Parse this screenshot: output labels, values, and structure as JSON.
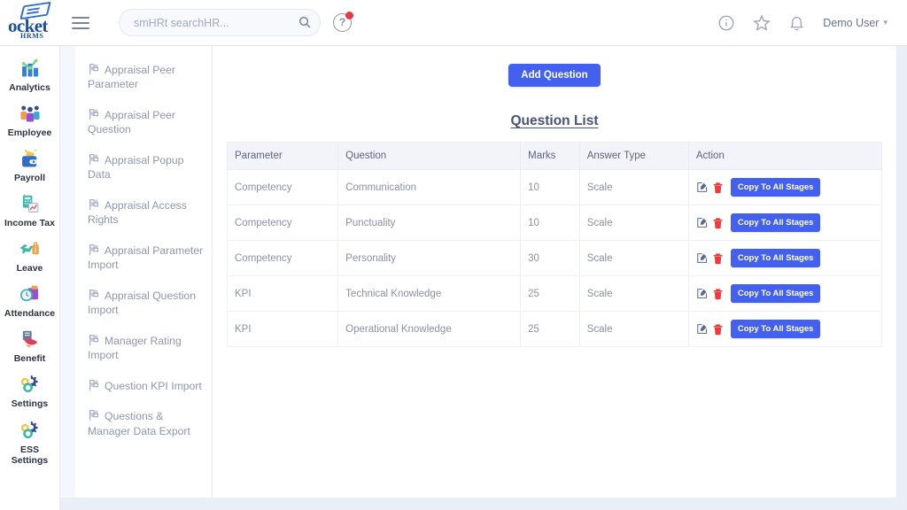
{
  "header": {
    "logo_text": "ocket",
    "logo_sub": "HRMS",
    "menu_icon": "hamburger-icon",
    "search": {
      "placeholder": "smHRt searchHR...",
      "value": "",
      "icon": "search-icon"
    },
    "help_icon": "help-circle-icon",
    "help_badge": true,
    "info_icon": "info-circle-icon",
    "star_icon": "star-icon",
    "bell_icon": "bell-icon",
    "user_label": "Demo User",
    "user_caret": "▾"
  },
  "rail": {
    "items": [
      {
        "label": "Analytics",
        "icon": "analytics-icon"
      },
      {
        "label": "Employee",
        "icon": "employee-icon"
      },
      {
        "label": "Payroll",
        "icon": "payroll-icon"
      },
      {
        "label": "Income Tax",
        "icon": "income-tax-icon"
      },
      {
        "label": "Leave",
        "icon": "leave-icon"
      },
      {
        "label": "Attendance",
        "icon": "attendance-icon"
      },
      {
        "label": "Benefit",
        "icon": "benefit-icon"
      },
      {
        "label": "Settings",
        "icon": "settings-icon"
      },
      {
        "label": "ESS Settings",
        "icon": "ess-settings-icon"
      }
    ]
  },
  "submenu": {
    "items": [
      {
        "label": "Appraisal Peer Parameter",
        "icon": "flag-icon"
      },
      {
        "label": "Appraisal Peer Question",
        "icon": "flag-icon"
      },
      {
        "label": "Appraisal Popup Data",
        "icon": "flag-icon"
      },
      {
        "label": "Appraisal Access Rights",
        "icon": "flag-icon"
      },
      {
        "label": "Appraisal Parameter Import",
        "icon": "flag-icon"
      },
      {
        "label": "Appraisal Question Import",
        "icon": "flag-icon"
      },
      {
        "label": "Manager Rating Import",
        "icon": "flag-icon"
      },
      {
        "label": "Question KPI Import",
        "icon": "flag-icon"
      },
      {
        "label": "Questions & Manager Data Export",
        "icon": "flag-icon"
      }
    ]
  },
  "main": {
    "add_button": "Add Question",
    "list_title": "Question List",
    "table": {
      "columns": [
        "Parameter",
        "Question",
        "Marks",
        "Answer Type",
        "Action"
      ],
      "rows": [
        {
          "parameter": "Competency",
          "question": "Communication",
          "marks": "10",
          "answer_type": "Scale",
          "edit_icon": "edit-icon",
          "delete_icon": "trash-icon",
          "copy_label": "Copy To All Stages"
        },
        {
          "parameter": "Competency",
          "question": "Punctuality",
          "marks": "10",
          "answer_type": "Scale",
          "edit_icon": "edit-icon",
          "delete_icon": "trash-icon",
          "copy_label": "Copy To All Stages"
        },
        {
          "parameter": "Competency",
          "question": "Personality",
          "marks": "30",
          "answer_type": "Scale",
          "edit_icon": "edit-icon",
          "delete_icon": "trash-icon",
          "copy_label": "Copy To All Stages"
        },
        {
          "parameter": "KPI",
          "question": "Technical Knowledge",
          "marks": "25",
          "answer_type": "Scale",
          "edit_icon": "edit-icon",
          "delete_icon": "trash-icon",
          "copy_label": "Copy To All Stages"
        },
        {
          "parameter": "KPI",
          "question": "Operational Knowledge",
          "marks": "25",
          "answer_type": "Scale",
          "edit_icon": "edit-icon",
          "delete_icon": "trash-icon",
          "copy_label": "Copy To All Stages"
        }
      ]
    }
  },
  "colors": {
    "accent": "#4361ee",
    "brand": "#1c4fa1",
    "danger": "#f03b3b",
    "badge": "#e63946",
    "page_bg": "#eaeff7",
    "table_head_bg": "#f2f4f9"
  }
}
